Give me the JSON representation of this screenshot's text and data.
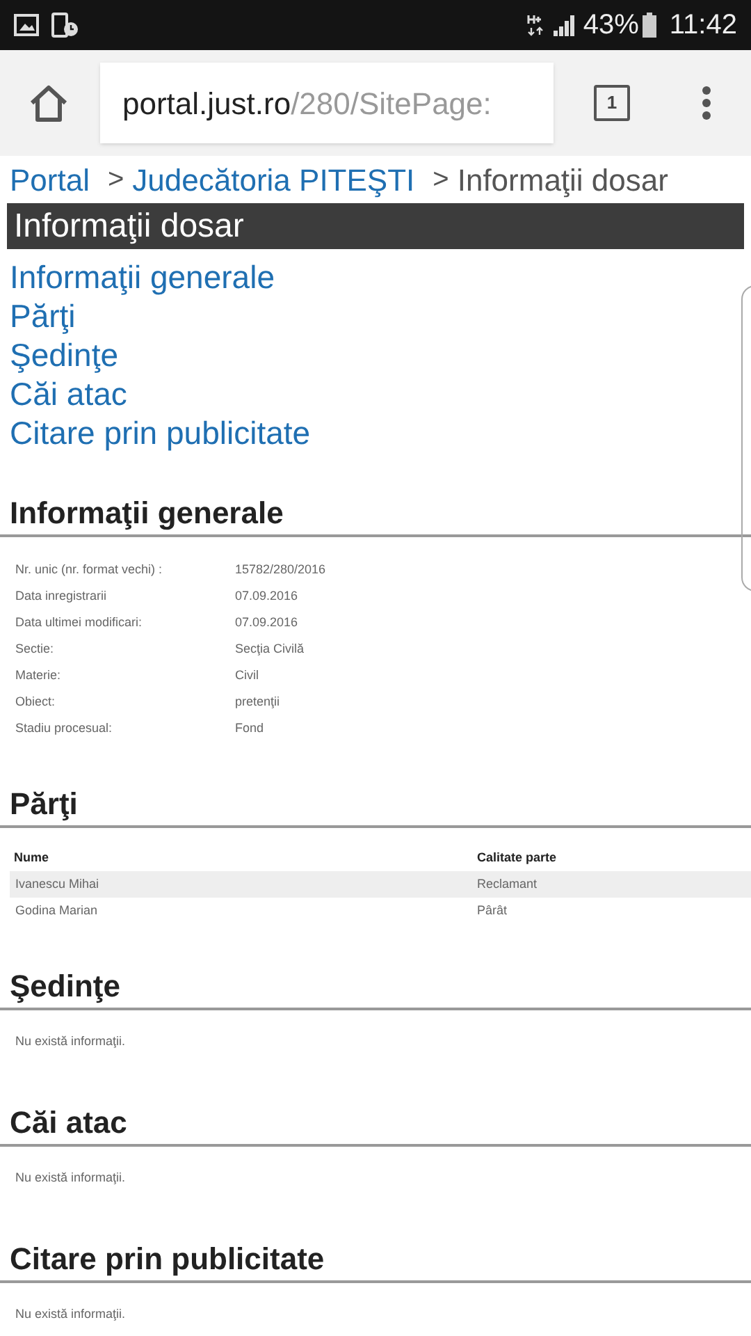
{
  "status_bar": {
    "battery_percent": "43%",
    "time": "11:42"
  },
  "browser": {
    "url_host": "portal.just.ro",
    "url_path": "/280/SitePage:",
    "tab_count": "1"
  },
  "breadcrumb": [
    {
      "label": "Portal",
      "kind": "link"
    },
    {
      "label": ">",
      "kind": "separator"
    },
    {
      "label": "Judecătoria PITEŞTI",
      "kind": "link"
    },
    {
      "label": ">",
      "kind": "separator"
    },
    {
      "label": "Informaţii dosar",
      "kind": "current"
    }
  ],
  "page_title": "Informaţii dosar",
  "nav_links": [
    "Informaţii generale",
    "Părţi",
    "Şedinţe",
    "Căi atac",
    "Citare prin publicitate"
  ],
  "sections": [
    {
      "kind": "fields",
      "title": "Informaţii generale",
      "fields": [
        {
          "label": "Nr. unic (nr. format vechi) :",
          "value": "15782/280/2016"
        },
        {
          "label": "Data inregistrarii",
          "value": "07.09.2016"
        },
        {
          "label": "Data ultimei modificari:",
          "value": "07.09.2016"
        },
        {
          "label": "Sectie:",
          "value": "Secţia Civilă"
        },
        {
          "label": "Materie:",
          "value": "Civil"
        },
        {
          "label": "Obiect:",
          "value": "pretenţii"
        },
        {
          "label": "Stadiu procesual:",
          "value": "Fond"
        }
      ]
    },
    {
      "kind": "table",
      "title": "Părţi",
      "columns": [
        "Nume",
        "Calitate parte"
      ],
      "rows": [
        {
          "cells": [
            "Ivanescu Mihai",
            "Reclamant"
          ]
        },
        {
          "cells": [
            "Godina Marian",
            "Pârât"
          ]
        }
      ]
    },
    {
      "kind": "empty",
      "title": "Şedinţe",
      "message": "Nu există informaţii."
    },
    {
      "kind": "empty",
      "title": "Căi atac",
      "message": "Nu există informaţii."
    },
    {
      "kind": "empty",
      "title": "Citare prin publicitate",
      "message": "Nu există informaţii."
    }
  ]
}
